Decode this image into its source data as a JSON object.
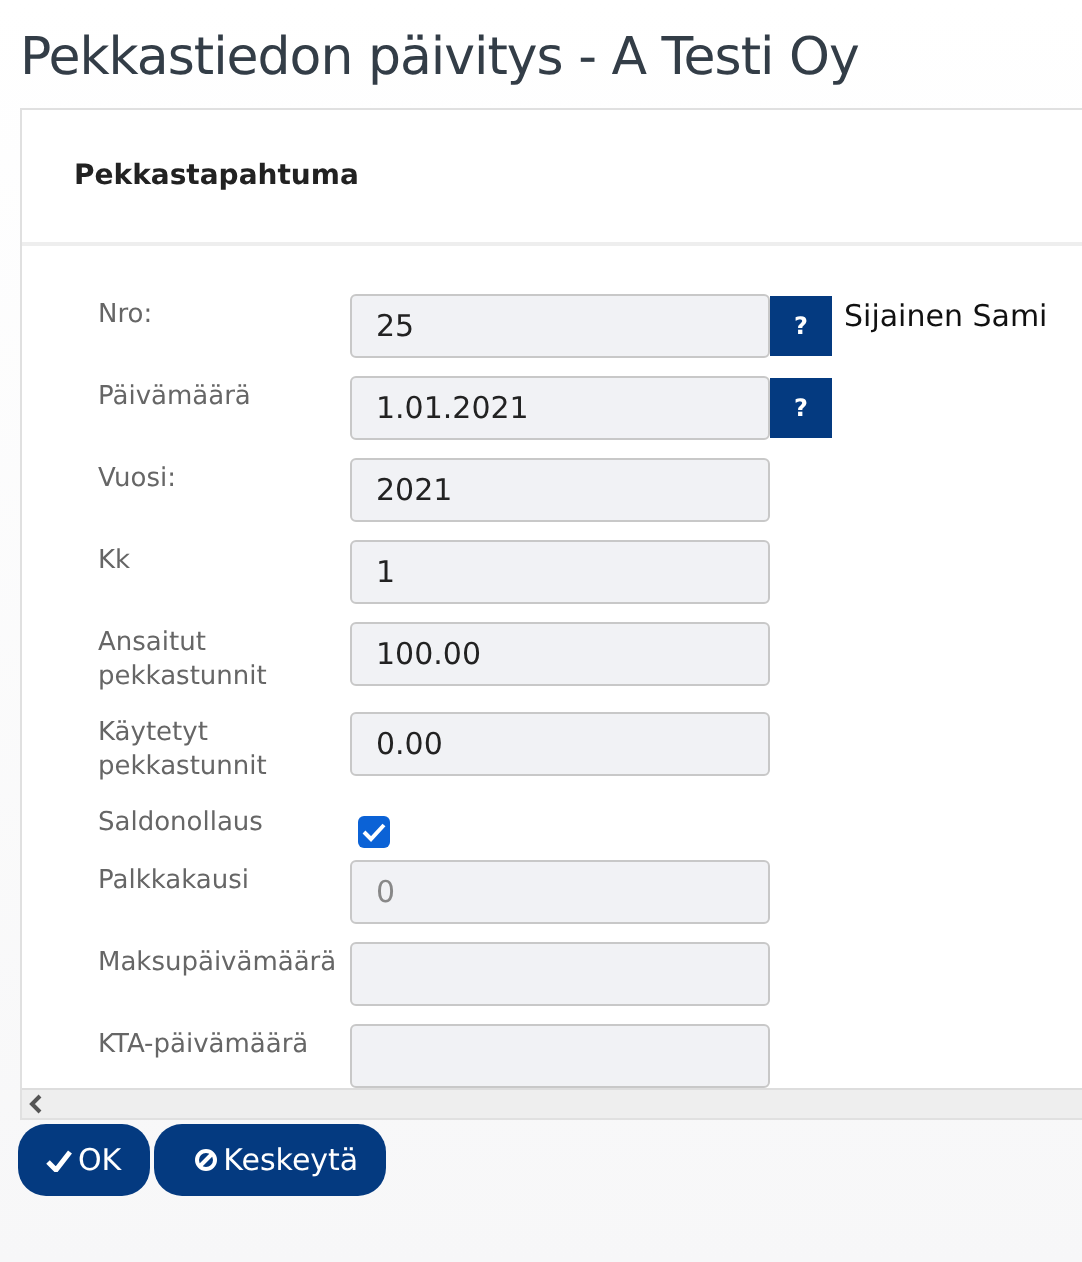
{
  "page": {
    "title": "Pekkastiedon päivitys - A Testi Oy"
  },
  "card": {
    "title": "Pekkastapahtuma",
    "side_note": "Sijainen Sami"
  },
  "fields": [
    {
      "kind": "text",
      "label": "Nro:",
      "value": "25",
      "help": "?"
    },
    {
      "kind": "text",
      "label": "Päivämäärä",
      "value": "1.01.2021",
      "help": "?"
    },
    {
      "kind": "text",
      "label": "Vuosi:",
      "value": "2021"
    },
    {
      "kind": "text",
      "label": "Kk",
      "value": "1"
    },
    {
      "kind": "text",
      "label": "Ansaitut pekkastunnit",
      "value": "100.00"
    },
    {
      "kind": "text",
      "label": "Käytetyt pekkastunnit",
      "value": "0.00"
    },
    {
      "kind": "checkbox",
      "label": "Saldonollaus",
      "checked": true
    },
    {
      "kind": "text",
      "label": "Palkkakausi",
      "placeholder": "0"
    },
    {
      "kind": "text",
      "label": "Maksupäivämäärä"
    },
    {
      "kind": "text",
      "label": "KTA-päivämäärä"
    }
  ],
  "buttons": [
    {
      "kind": "ok",
      "label": "OK"
    },
    {
      "kind": "cancel",
      "label": "Keskeytä"
    }
  ]
}
